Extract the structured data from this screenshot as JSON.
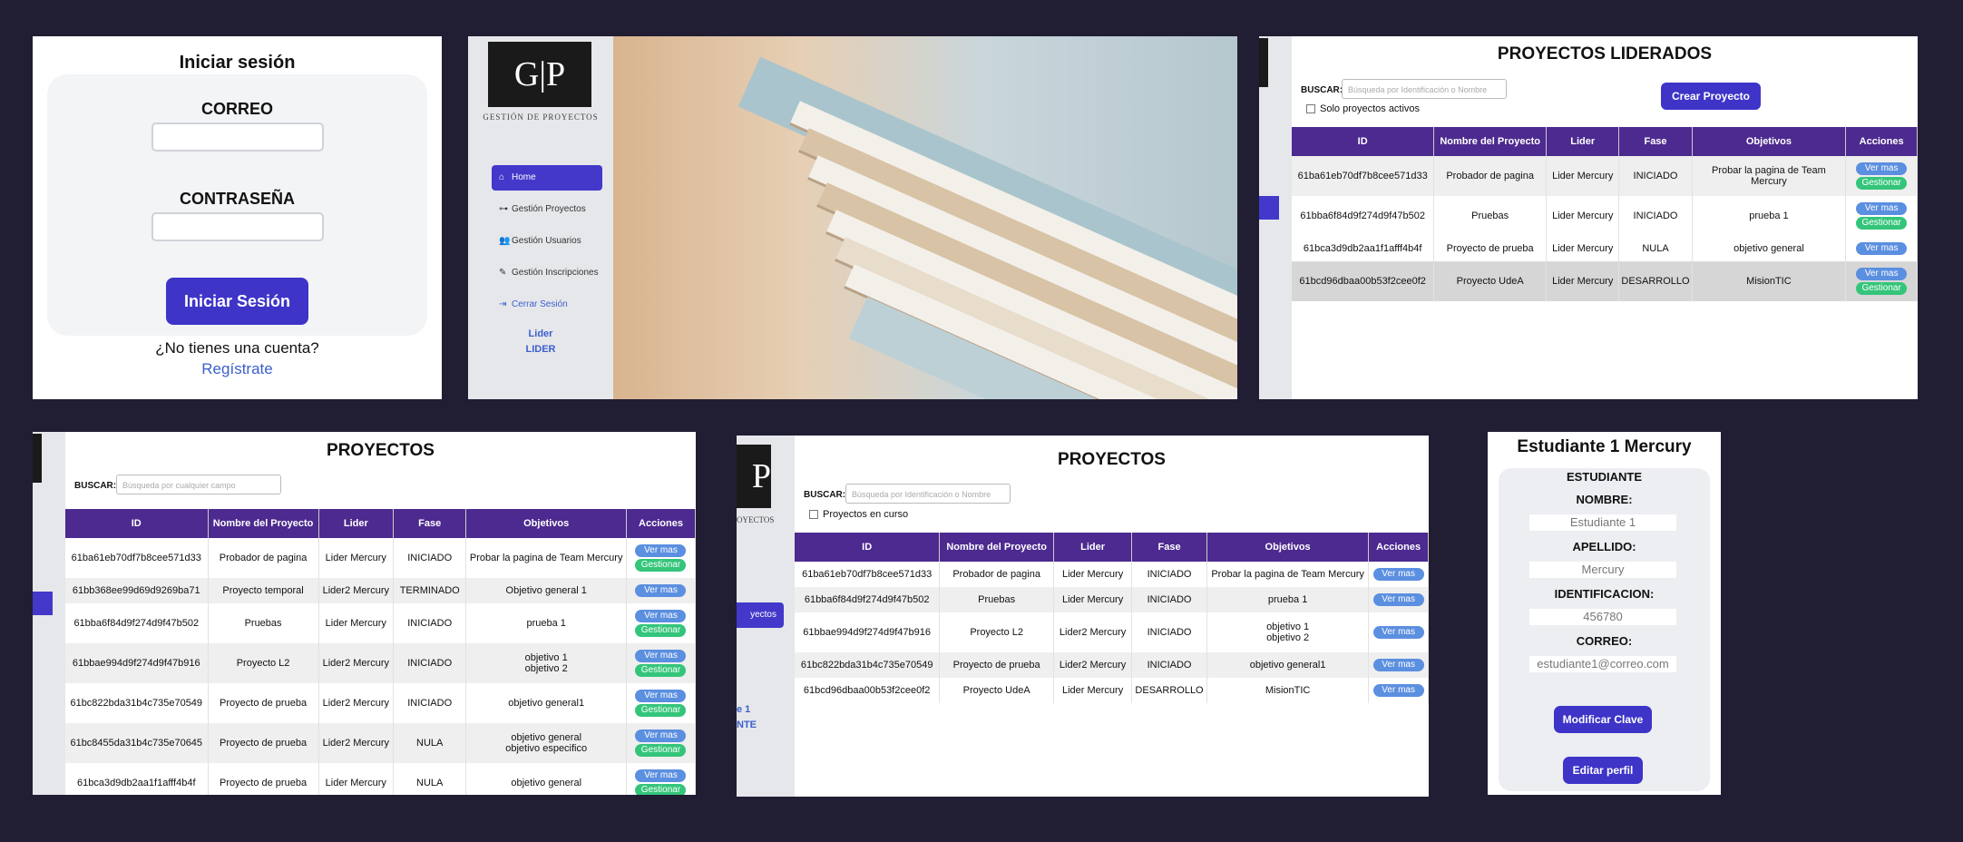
{
  "login": {
    "title": "Iniciar sesión",
    "email_label": "CORREO",
    "password_label": "CONTRASEÑA",
    "submit_label": "Iniciar Sesión",
    "no_account": "¿No tienes una cuenta?",
    "register_link": "Regístrate"
  },
  "brand": {
    "logo_text": "G|P",
    "subtitle": "GESTIÓN DE PROYECTOS"
  },
  "home_sidebar": {
    "items": [
      {
        "label": "Home",
        "icon": "home-icon"
      },
      {
        "label": "Gestión Proyectos",
        "icon": "diagram-icon"
      },
      {
        "label": "Gestión Usuarios",
        "icon": "users-icon"
      },
      {
        "label": "Gestión Inscripciones",
        "icon": "edit-icon"
      },
      {
        "label": "Cerrar Sesión",
        "icon": "logout-icon"
      }
    ],
    "user_name": "Lider",
    "user_role": "LIDER"
  },
  "led_projects": {
    "title": "PROYECTOS LIDERADOS",
    "search_label": "BUSCAR:",
    "search_placeholder": "Búsqueda por Identificación o Nombre",
    "active_only": "Solo proyectos activos",
    "create_button": "Crear Proyecto",
    "columns": [
      "ID",
      "Nombre del Proyecto",
      "Lider",
      "Fase",
      "Objetivos",
      "Acciones"
    ],
    "rows": [
      {
        "id": "61ba61eb70df7b8cee571d33",
        "name": "Probador de pagina",
        "leader": "Lider Mercury",
        "phase": "INICIADO",
        "objectives": "Probar la pagina de Team Mercury",
        "manage": true
      },
      {
        "id": "61bba6f84d9f274d9f47b502",
        "name": "Pruebas",
        "leader": "Lider Mercury",
        "phase": "INICIADO",
        "objectives": "prueba 1",
        "manage": true
      },
      {
        "id": "61bca3d9db2aa1f1afff4b4f",
        "name": "Proyecto de prueba",
        "leader": "Lider Mercury",
        "phase": "NULA",
        "objectives": "objetivo general",
        "manage": false
      },
      {
        "id": "61bcd96dbaa00b53f2cee0f2",
        "name": "Proyecto UdeA",
        "leader": "Lider Mercury",
        "phase": "DESARROLLO",
        "objectives": "MisionTIC",
        "manage": true
      }
    ]
  },
  "all_projects": {
    "title": "PROYECTOS",
    "search_label": "BUSCAR:",
    "search_placeholder": "Búsqueda por cualquier campo",
    "columns": [
      "ID",
      "Nombre del Proyecto",
      "Lider",
      "Fase",
      "Objetivos",
      "Acciones"
    ],
    "rows": [
      {
        "id": "61ba61eb70df7b8cee571d33",
        "name": "Probador de pagina",
        "leader": "Lider Mercury",
        "phase": "INICIADO",
        "objectives": [
          "Probar la pagina de Team Mercury"
        ],
        "manage": true
      },
      {
        "id": "61bb368ee99d69d9269ba71",
        "name": "Proyecto temporal",
        "leader": "Lider2 Mercury",
        "phase": "TERMINADO",
        "objectives": [
          "Objetivo general 1"
        ],
        "manage": false
      },
      {
        "id": "61bba6f84d9f274d9f47b502",
        "name": "Pruebas",
        "leader": "Lider Mercury",
        "phase": "INICIADO",
        "objectives": [
          "prueba 1"
        ],
        "manage": true
      },
      {
        "id": "61bbae994d9f274d9f47b916",
        "name": "Proyecto L2",
        "leader": "Lider2 Mercury",
        "phase": "INICIADO",
        "objectives": [
          "objetivo 1",
          "objetivo 2"
        ],
        "manage": true
      },
      {
        "id": "61bc822bda31b4c735e70549",
        "name": "Proyecto de prueba",
        "leader": "Lider2 Mercury",
        "phase": "INICIADO",
        "objectives": [
          "objetivo general1"
        ],
        "manage": true
      },
      {
        "id": "61bc8455da31b4c735e70645",
        "name": "Proyecto de prueba",
        "leader": "Lider2 Mercury",
        "phase": "NULA",
        "objectives": [
          "objetivo general",
          "objetivo especifico"
        ],
        "manage": true
      },
      {
        "id": "61bca3d9db2aa1f1afff4b4f",
        "name": "Proyecto de prueba",
        "leader": "Lider Mercury",
        "phase": "NULA",
        "objectives": [
          "objetivo general"
        ],
        "manage": true
      }
    ]
  },
  "student_projects": {
    "title": "PROYECTOS",
    "search_label": "BUSCAR:",
    "search_placeholder": "Búsqueda por Identificación o Nombre",
    "in_progress": "Proyectos en curso",
    "sidebar_fragment": "yectos",
    "user_fragment": "e 1",
    "role_fragment": "NTE",
    "logo_fragment": "P",
    "logo_sub_fragment": "OYECTOS",
    "columns": [
      "ID",
      "Nombre del Proyecto",
      "Lider",
      "Fase",
      "Objetivos",
      "Acciones"
    ],
    "rows": [
      {
        "id": "61ba61eb70df7b8cee571d33",
        "name": "Probador de pagina",
        "leader": "Lider Mercury",
        "phase": "INICIADO",
        "objectives": [
          "Probar la pagina de Team Mercury"
        ]
      },
      {
        "id": "61bba6f84d9f274d9f47b502",
        "name": "Pruebas",
        "leader": "Lider Mercury",
        "phase": "INICIADO",
        "objectives": [
          "prueba 1"
        ]
      },
      {
        "id": "61bbae994d9f274d9f47b916",
        "name": "Proyecto L2",
        "leader": "Lider2 Mercury",
        "phase": "INICIADO",
        "objectives": [
          "objetivo 1",
          "objetivo 2"
        ]
      },
      {
        "id": "61bc822bda31b4c735e70549",
        "name": "Proyecto de prueba",
        "leader": "Lider2 Mercury",
        "phase": "INICIADO",
        "objectives": [
          "objetivo general1"
        ]
      },
      {
        "id": "61bcd96dbaa00b53f2cee0f2",
        "name": "Proyecto UdeA",
        "leader": "Lider Mercury",
        "phase": "DESARROLLO",
        "objectives": [
          "MisionTIC"
        ]
      }
    ]
  },
  "actions": {
    "view": "Ver mas",
    "manage": "Gestionar"
  },
  "profile": {
    "title": "Estudiante 1 Mercury",
    "role": "ESTUDIANTE",
    "name_label": "NOMBRE:",
    "name_value": "Estudiante 1",
    "lastname_label": "APELLIDO:",
    "lastname_value": "Mercury",
    "id_label": "IDENTIFICACION:",
    "id_value": "456780",
    "email_label": "CORREO:",
    "email_value": "estudiante1@correo.com",
    "change_password": "Modificar Clave",
    "edit_profile": "Editar perfil"
  },
  "colors": {
    "background": "#211d33",
    "primary": "#3e34c8",
    "table_header": "#4c2a8f",
    "view_button": "#5b8fe0",
    "manage_button": "#34c57a",
    "link": "#3b5fcc"
  }
}
